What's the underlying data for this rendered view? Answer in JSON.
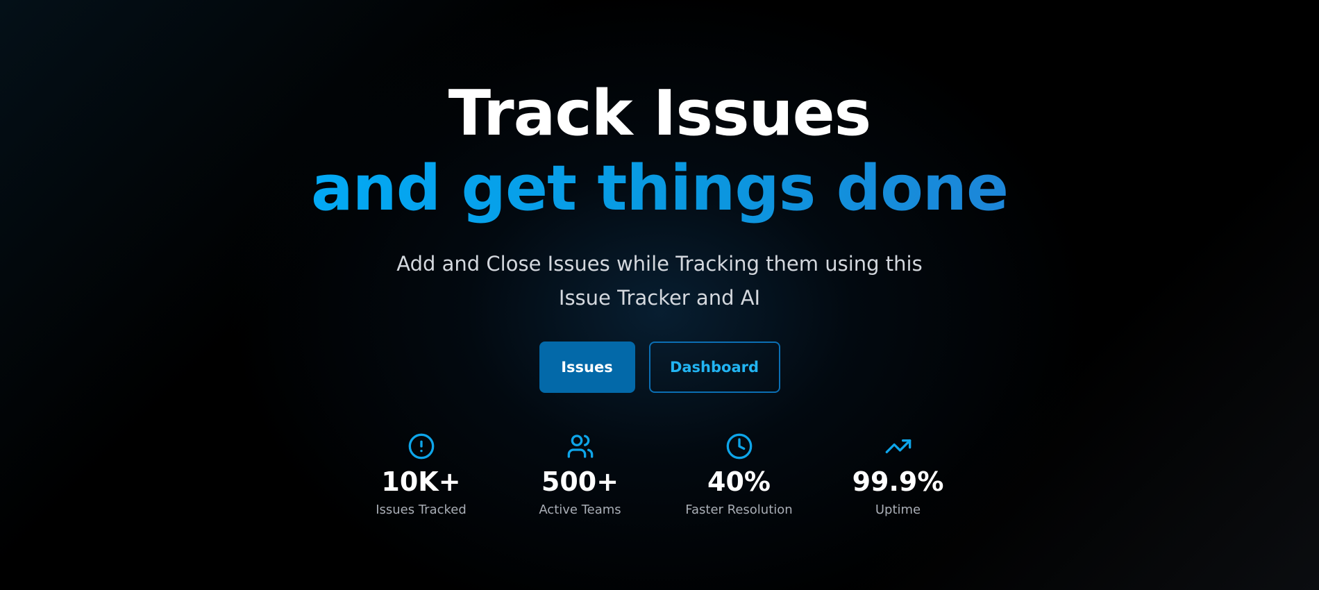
{
  "hero": {
    "title_line1": "Track Issues",
    "title_line2": "and get things done",
    "subtitle": "Add and Close Issues while Tracking them using this Issue Tracker and AI"
  },
  "buttons": {
    "issues_label": "Issues",
    "dashboard_label": "Dashboard"
  },
  "stats": [
    {
      "icon": "alert-circle-icon",
      "value": "10K+",
      "label": "Issues Tracked"
    },
    {
      "icon": "users-icon",
      "value": "500+",
      "label": "Active Teams"
    },
    {
      "icon": "clock-icon",
      "value": "40%",
      "label": "Faster Resolution"
    },
    {
      "icon": "trending-up-icon",
      "value": "99.9%",
      "label": "Uptime"
    }
  ],
  "colors": {
    "accent": "#03a9f4",
    "primary_button": "#0369a9",
    "outline_border": "#0b6fb4",
    "background": "#000000"
  }
}
